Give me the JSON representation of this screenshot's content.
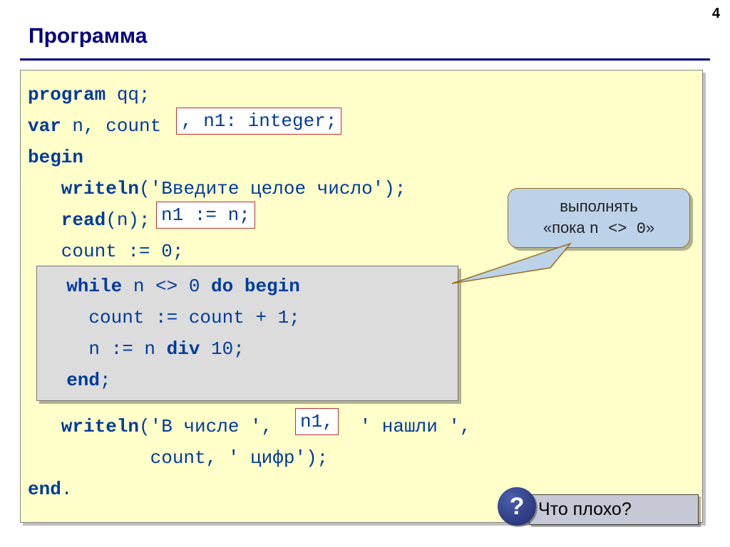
{
  "pageNumber": "4",
  "title": "Программа",
  "code": {
    "l1a": "program",
    "l1b": " qq;",
    "l2a": "var",
    "l2b": " n, count",
    "insert1": ", n1: integer;",
    "l3": "begin",
    "l4a": "   writeln",
    "l4b": "('Введите целое число');",
    "l5a": "   read",
    "l5b": "(n); ",
    "insert2": "n1 := n;",
    "l6": "   count := 0;",
    "w1a": "  while",
    "w1b": " n <> 0 ",
    "w1c": "do begin",
    "w2": "    count := count + 1;",
    "w3a": "    n := n ",
    "w3b": "div",
    "w3c": " 10;",
    "w4": "  end",
    "w4b": ";",
    "l8a": "   writeln",
    "l8b": "('В числе ', ",
    "insert3": "n1,",
    "l8c": " ' нашли ',",
    "l9": "           count, ' цифр');",
    "l10a": "end",
    "l10b": "."
  },
  "callout": {
    "line1": "выполнять",
    "line2a": "«пока ",
    "line2mono": "n <> 0",
    "line2b": "»"
  },
  "question": "Что плохо?"
}
